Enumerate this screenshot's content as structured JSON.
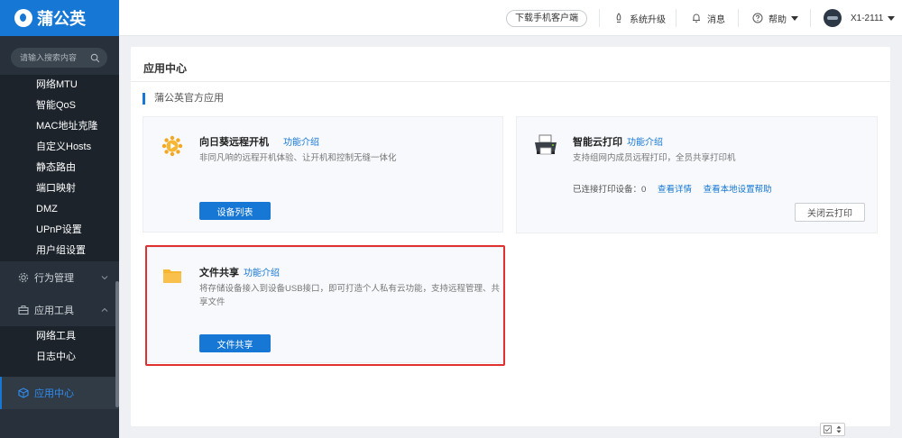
{
  "brand": {
    "name": "蒲公英"
  },
  "search": {
    "placeholder": "请输入搜索内容"
  },
  "sidebar": {
    "sub_items": [
      "网络MTU",
      "智能QoS",
      "MAC地址克隆",
      "自定义Hosts",
      "静态路由",
      "端口映射",
      "DMZ",
      "UPnP设置",
      "用户组设置"
    ],
    "group_behavior": "行为管理",
    "group_tools": "应用工具",
    "tools_items": [
      "网络工具",
      "日志中心"
    ],
    "active_item": "应用中心"
  },
  "topbar": {
    "download_label": "下载手机客户端",
    "upgrade_label": "系统升级",
    "message_label": "消息",
    "help_label": "帮助",
    "device_label": "X1-2111"
  },
  "main": {
    "title": "应用中心",
    "section": "蒲公英官方应用",
    "cards": {
      "remote": {
        "title": "向日葵远程开机",
        "link": "功能介绍",
        "desc": "非同凡响的远程开机体验、让开机和控制无缝一体化",
        "button": "设备列表"
      },
      "print": {
        "title": "智能云打印",
        "link": "功能介绍",
        "desc": "支持组网内成员远程打印，全员共享打印机",
        "status_label": "已连接打印设备：",
        "status_count": "0",
        "detail_link": "查看详情",
        "help_link": "查看本地设置帮助",
        "button": "关闭云打印"
      },
      "share": {
        "title": "文件共享",
        "link": "功能介绍",
        "desc_line1": "将存储设备接入到设备USB接口，即可打造个人私有云功能，支持远程管理、共",
        "desc_line2": "享文件",
        "button": "文件共享"
      }
    }
  },
  "colors": {
    "brand_blue": "#1677d4",
    "sidebar_bg": "#28313b",
    "highlight_red": "#e03131"
  }
}
